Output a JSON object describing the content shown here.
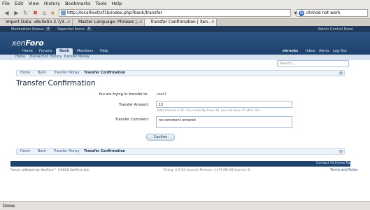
{
  "browser": {
    "menu": [
      "File",
      "Edit",
      "View",
      "History",
      "Bookmarks",
      "Tools",
      "Help"
    ],
    "url": "http://localhost/xf1b/index.php?bank/transfer",
    "search_value": "chmod not work",
    "search_engine_icon": "G",
    "tabs": [
      {
        "label": "Import Data: vBulletin 3.7/3...",
        "active": false
      },
      {
        "label": "Master Language: Phrases |...",
        "active": false
      },
      {
        "label": "Transfer Confirmation | Xen...",
        "active": true
      }
    ],
    "status": "Done"
  },
  "forum": {
    "topbar": {
      "moderation_queue": "Moderation Queue",
      "moderation_count": "0",
      "reported_items": "Reported Items",
      "reported_count": "0",
      "admin_panel": "Admin Control Panel"
    },
    "logo_a": "xen",
    "logo_b": "Foro",
    "nav": {
      "tabs": [
        "Home",
        "Forums",
        "Bank",
        "Members",
        "Help"
      ],
      "selected": "Bank",
      "user": "shrooks",
      "user_links": [
        "Inbox",
        "Alerts",
        "Log Out"
      ]
    },
    "subnav": [
      "Home",
      "Transaction History",
      "Transfer Money"
    ],
    "search_placeholder": "Search...",
    "breadcrumbs": [
      "Home",
      "Bank",
      "Transfer Money",
      "Transfer Confirmation"
    ],
    "page_title": "Transfer Confirmation",
    "form": {
      "transfer_to_label": "You are trying to transfer to:",
      "transfer_to_value": "user1",
      "amount_label": "Transfer Amount:",
      "amount_value": "15",
      "amount_hint": "Total amount is 15. You currently have 30, you will have 15 after this.",
      "comment_label": "Transfer Comment:",
      "comment_value": "no comment entered",
      "confirm_label": "Confirm"
    },
    "footer": {
      "links": [
        "Contact Us",
        "Home",
        "Top"
      ],
      "copyright": "Forum software by XenForo™ ©2010 XenForo Ltd.",
      "debug": "Timing: 0.5783 seconds Memory: 4.479 MB DB Queries: 8",
      "terms": "Terms and Rules"
    }
  }
}
